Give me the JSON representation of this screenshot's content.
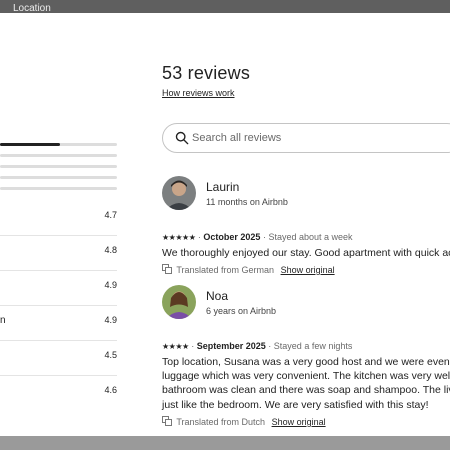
{
  "background": {
    "header_text": "Location"
  },
  "rating_bars": [
    1.0,
    0.0,
    0.0,
    0.0,
    0.0
  ],
  "categories": [
    {
      "label": "",
      "score": "4.7"
    },
    {
      "label": "",
      "score": "4.8"
    },
    {
      "label": "",
      "score": "4.9"
    },
    {
      "label": "n",
      "score": "4.9"
    },
    {
      "label": "",
      "score": "4.5"
    },
    {
      "label": "",
      "score": "4.6"
    }
  ],
  "reviews_header": {
    "title": "53 reviews",
    "how_link": "How reviews work"
  },
  "search": {
    "placeholder": "Search all reviews",
    "icon": "search-icon"
  },
  "reviews": [
    {
      "name": "Laurin",
      "meta": "11 months on Airbnb",
      "stars": "★★★★★",
      "date": "October 2025",
      "stay": "Stayed about a week",
      "body": [
        "We thoroughly enjoyed our stay. Good apartment with quick ac"
      ],
      "translated": "Translated from German",
      "show_original": "Show original"
    },
    {
      "name": "Noa",
      "meta": "6 years on Airbnb",
      "stars": "★★★★",
      "date": "September 2025",
      "stay": "Stayed a few nights",
      "body": [
        "Top location, Susana was a very good host and we were even all",
        "luggage which was very convenient. The kitchen was very well e",
        "bathroom was clean and there was soap and shampoo. The livin",
        "just like the bedroom. We are very satisfied with this stay!"
      ],
      "translated": "Translated from Dutch",
      "show_original": "Show original"
    }
  ],
  "colors": {
    "text": "#222222",
    "muted": "#6a6a6a",
    "border": "#c4c4c4",
    "bar_bg": "#dddddd"
  }
}
